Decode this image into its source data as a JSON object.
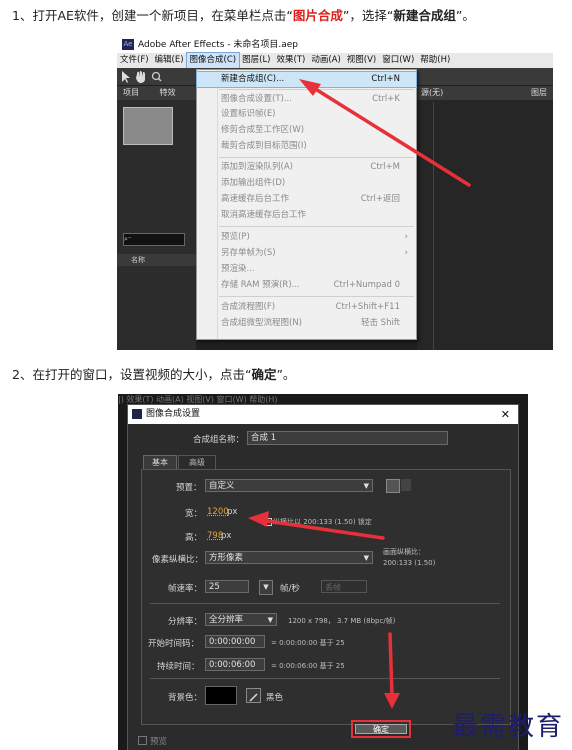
{
  "step1": {
    "prefix": "1、打开AE软件，创建一个新项目，在菜单栏点击“",
    "highlight": "图片合成",
    "middle": "”，选择“",
    "bold": "新建合成组",
    "suffix": "”。"
  },
  "step2": {
    "prefix": "2、在打开的窗口，设置视频的大小，点击“",
    "bold": "确定",
    "suffix": "”。"
  },
  "ae_window": {
    "app_icon": "Ae",
    "title": "Adobe After Effects - 未命名项目.aep",
    "menu": [
      "文件(F)",
      "编辑(E)",
      "图像合成(C)",
      "图层(L)",
      "效果(T)",
      "动画(A)",
      "视图(V)",
      "窗口(W)",
      "帮助(H)"
    ],
    "panel_tabs": [
      "项目",
      "特效"
    ],
    "side_tab": "图层",
    "side_value": "源(无)",
    "name_column": "名称",
    "menu_items": [
      {
        "label": "新建合成组(C)...",
        "shortcut": "Ctrl+N",
        "state": "highlight"
      },
      {
        "label": "图像合成设置(T)...",
        "shortcut": "Ctrl+K",
        "state": "disabled"
      },
      {
        "label": "设置标识帧(E)",
        "shortcut": "",
        "state": "disabled"
      },
      {
        "label": "修剪合成至工作区(W)",
        "shortcut": "",
        "state": "disabled"
      },
      {
        "label": "裁剪合成到目标范围(I)",
        "shortcut": "",
        "state": "disabled"
      },
      {
        "label": "添加到渲染队列(A)",
        "shortcut": "Ctrl+M",
        "state": "disabled"
      },
      {
        "label": "添加输出组件(D)",
        "shortcut": "",
        "state": "disabled"
      },
      {
        "label": "高速缓存后台工作",
        "shortcut": "Ctrl+返回",
        "state": "disabled"
      },
      {
        "label": "取消高速缓存后台工作",
        "shortcut": "",
        "state": "disabled"
      },
      {
        "label": "预览(P)",
        "shortcut": "›",
        "state": "disabled"
      },
      {
        "label": "另存单帧为(S)",
        "shortcut": "›",
        "state": "disabled"
      },
      {
        "label": "预渲染...",
        "shortcut": "",
        "state": "disabled"
      },
      {
        "label": "存储 RAM 预演(R)...",
        "shortcut": "Ctrl+Numpad 0",
        "state": "disabled"
      },
      {
        "label": "合成流程图(F)",
        "shortcut": "Ctrl+Shift+F11",
        "state": "disabled"
      },
      {
        "label": "合成组微型流程图(N)",
        "shortcut": "轻击 Shift",
        "state": "disabled"
      }
    ]
  },
  "dialog": {
    "bg_menu": "|) 效果(T)  动画(A)  视图(V)  窗口(W)  帮助(H)",
    "title": "图像合成设置",
    "close": "✕",
    "comp_name_label": "合成组名称：",
    "comp_name_value": "合成 1",
    "tabs": [
      "基本",
      "高级"
    ],
    "preset_label": "预置：",
    "preset_value": "自定义",
    "width_label": "宽：",
    "width_value": "1200",
    "width_unit": "px",
    "height_label": "高：",
    "height_value": "798",
    "height_unit": "px",
    "lock_label": "纵横比以 200:133 (1.50) 锁定",
    "pixel_aspect_label": "像素纵横比：",
    "pixel_aspect_value": "方形像素",
    "frame_aspect_label": "画面纵横比：",
    "frame_aspect_value": "200:133 (1.50)",
    "frame_rate_label": "帧速率：",
    "frame_rate_value": "25",
    "frame_rate_unit": "帧/秒",
    "frame_rate_drop": "丢帧",
    "resolution_label": "分辨率：",
    "resolution_value": "全分辨率",
    "resolution_info": "1200 x 798， 3.7 MB (8bpc/帧)",
    "start_tc_label": "开始时间码：",
    "start_tc_value": "0:00:00:00",
    "start_tc_info": "= 0:00:00:00  基于 25",
    "duration_label": "持续时间：",
    "duration_value": "0:00:06:00",
    "duration_info": "= 0:00:06:00  基于 25",
    "bg_color_label": "背景色：",
    "bg_color_name": "黑色",
    "bg_color": "#000000",
    "preview_label": "预览",
    "ok_label": "确定"
  },
  "watermark": "最需教育",
  "colors": {
    "highlight_red": "#e0201b",
    "arrow_red": "#e8303a",
    "accent_orange": "#e8a23a"
  }
}
